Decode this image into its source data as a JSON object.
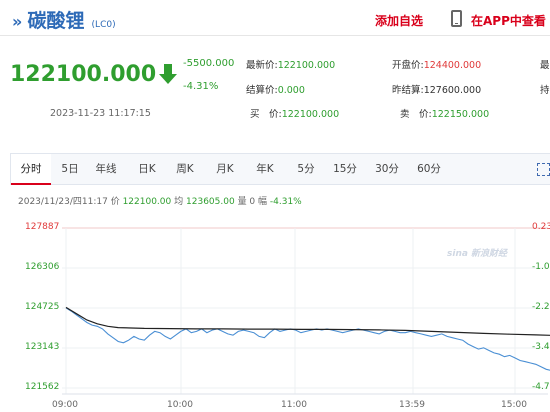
{
  "header": {
    "title_arrow": "»",
    "title": "碳酸锂",
    "code": "(LC0)",
    "add_watch": "添加自选",
    "app_view": "在APP中查看"
  },
  "quote": {
    "price": "122100.000",
    "change": "-5500.000",
    "change_pct": "-4.31%",
    "datetime": "2023-11-23 11:17:15",
    "fields": [
      {
        "label": "最新价:",
        "value": "122100.000"
      },
      {
        "label": "结算价:",
        "value": "0.000"
      },
      {
        "label": "买　价:",
        "value": "122100.000"
      },
      {
        "label": "开盘价:",
        "value": "124400.000"
      },
      {
        "label": "昨结算:",
        "value": "127600.000"
      },
      {
        "label": "卖　价:",
        "value": "122150.000"
      },
      {
        "label": "最",
        "value": ""
      },
      {
        "label": "持",
        "value": ""
      }
    ]
  },
  "tabs": [
    "分时",
    "5日",
    "日K",
    "日K",
    "周K",
    "月K",
    "年K",
    "5分",
    "15分",
    "30分",
    "60分"
  ],
  "chart_info": {
    "label": "2023/11/23/四11:17 价",
    "price": "122100.00",
    "avg_label": "均",
    "avg": "123605.00",
    "vol_label": "量 0 幅",
    "pct": "-4.31%"
  },
  "watermark": "sina 新浪财经",
  "colors": {
    "up": "#e03a3a",
    "down": "#2f9e2f",
    "brand": "#2d6ab7",
    "accent": "#d9001b",
    "price_line": "#4a8fd4",
    "avg_line": "#222222"
  },
  "chart_data": {
    "type": "line",
    "title": "",
    "ylim": [
      121562,
      127887
    ],
    "y_ticks": [
      "127887",
      "126306",
      "124725",
      "123143",
      "121562"
    ],
    "y_ticks_right": [
      "0.23%",
      "-1.0",
      "-2.2",
      "-3.4",
      "-4.7"
    ],
    "x_ticks": [
      "09:00",
      "10:00",
      "11:00",
      "13:59",
      "15:00"
    ],
    "series": [
      {
        "x": [
          0,
          1,
          2,
          3,
          4,
          5,
          6,
          7,
          8,
          9,
          10,
          11,
          12,
          13,
          14,
          15,
          16,
          17,
          18,
          19,
          20,
          21,
          22,
          23,
          24,
          25,
          26,
          27,
          28,
          29,
          30,
          31,
          32,
          33,
          34,
          35,
          36,
          37,
          38,
          39,
          40,
          41,
          42,
          43,
          44,
          45,
          46,
          47,
          48,
          49,
          50,
          51,
          52,
          53,
          54,
          55,
          56,
          57,
          58,
          59,
          60,
          61,
          62,
          63,
          64,
          65,
          66,
          67,
          68,
          69,
          70,
          71,
          72,
          73,
          74,
          75,
          76,
          77,
          78,
          79,
          80,
          81,
          82,
          83,
          84,
          85,
          86,
          87,
          88,
          89,
          90,
          91,
          92,
          93,
          94,
          95,
          96,
          97
        ],
        "y": [
          124730,
          124600,
          124450,
          124300,
          124150,
          124050,
          124000,
          123900,
          123700,
          123550,
          123400,
          123350,
          123450,
          123600,
          123500,
          123450,
          123650,
          123800,
          123750,
          123600,
          123500,
          123650,
          123800,
          123900,
          123750,
          123800,
          123900,
          123750,
          123850,
          123900,
          123800,
          123700,
          123650,
          123800,
          123850,
          123800,
          123750,
          123600,
          123550,
          123750,
          123900,
          123800,
          123850,
          123900,
          123850,
          123750,
          123800,
          123850,
          123900,
          123850,
          123900,
          123850,
          123800,
          123750,
          123800,
          123850,
          123900,
          123850,
          123800,
          123750,
          123700,
          123800,
          123850,
          123800,
          123750,
          123750,
          123800,
          123750,
          123700,
          123650,
          123600,
          123650,
          123700,
          123600,
          123550,
          123500,
          123450,
          123300,
          123200,
          123100,
          123150,
          123050,
          122950,
          122900,
          122800,
          122850,
          122750,
          122650,
          122600,
          122550,
          122500,
          122400,
          122300,
          122250,
          122150,
          122000,
          122200,
          122100
        ]
      },
      {
        "x": [
          0,
          2,
          4,
          6,
          8,
          10,
          15,
          20,
          25,
          30,
          35,
          40,
          45,
          50,
          55,
          60,
          65,
          70,
          75,
          80,
          85,
          90,
          97
        ],
        "y": [
          124750,
          124500,
          124250,
          124100,
          124000,
          123950,
          123920,
          123910,
          123900,
          123900,
          123890,
          123890,
          123880,
          123880,
          123870,
          123860,
          123840,
          123800,
          123760,
          123720,
          123690,
          123660,
          123620
        ]
      }
    ]
  }
}
